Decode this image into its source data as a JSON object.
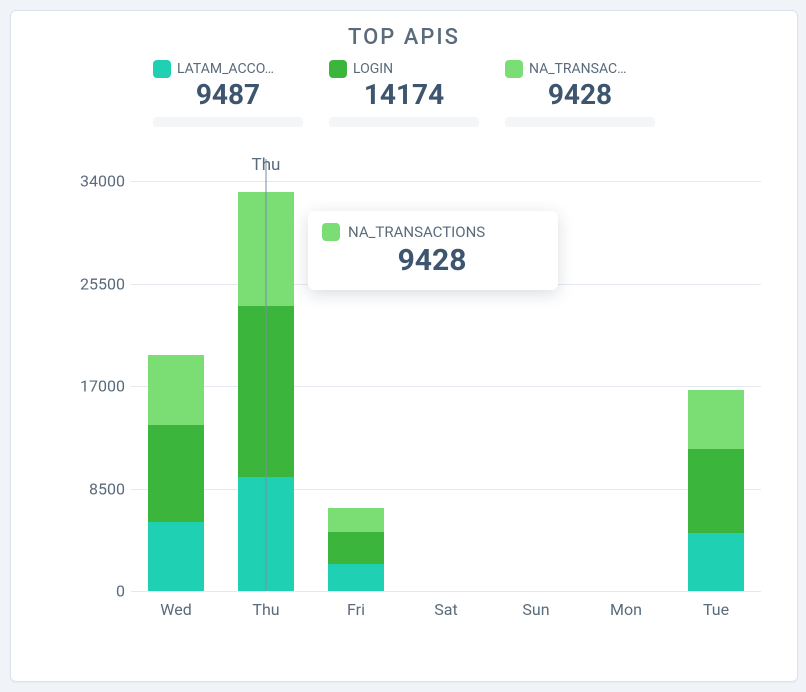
{
  "title": "TOP APIS",
  "colors": {
    "s1": "#1fd1b2",
    "s2": "#3cb53c",
    "s3": "#7ade74"
  },
  "legend": [
    {
      "key": "s1",
      "label": "LATAM_ACCO…",
      "value": "9487"
    },
    {
      "key": "s2",
      "label": "LOGIN",
      "value": "14174"
    },
    {
      "key": "s3",
      "label": "NA_TRANSAC…",
      "value": "9428"
    }
  ],
  "highlight": {
    "category": "Thu",
    "tooltip": {
      "key": "s3",
      "label": "NA_TRANSACTIONS",
      "value": "9428"
    }
  },
  "chart_data": {
    "type": "bar",
    "stacked": true,
    "title": "TOP APIS",
    "xlabel": "",
    "ylabel": "",
    "ylim": [
      0,
      34000
    ],
    "y_ticks": [
      0,
      8500,
      17000,
      25500,
      34000
    ],
    "categories": [
      "Wed",
      "Thu",
      "Fri",
      "Sat",
      "Sun",
      "Mon",
      "Tue"
    ],
    "series": [
      {
        "name": "LATAM_ACCOUNTS",
        "key": "s1",
        "values": [
          5700,
          9487,
          2200,
          0,
          0,
          0,
          4800
        ]
      },
      {
        "name": "LOGIN",
        "key": "s2",
        "values": [
          8100,
          14174,
          2700,
          0,
          0,
          0,
          7000
        ]
      },
      {
        "name": "NA_TRANSACTIONS",
        "key": "s3",
        "values": [
          5800,
          9428,
          2000,
          0,
          0,
          0,
          4900
        ]
      }
    ]
  }
}
